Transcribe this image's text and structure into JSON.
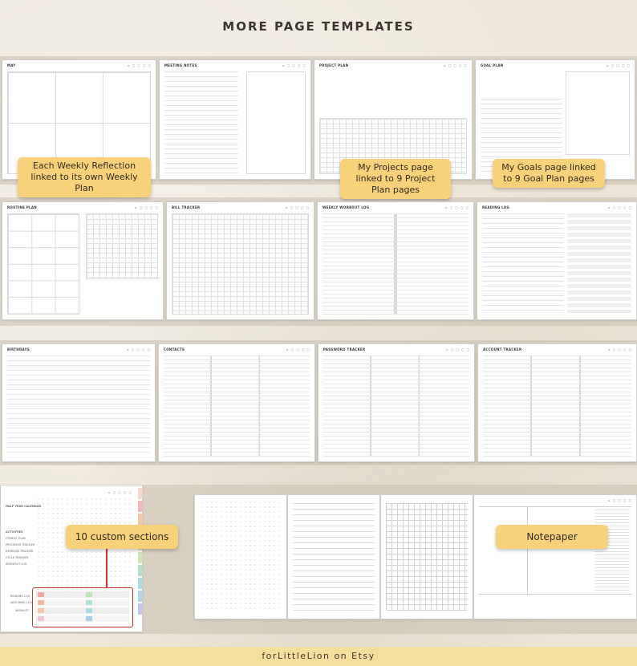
{
  "heading": "MORE PAGE TEMPLATES",
  "footer": "forLittleLion on Etsy",
  "callouts": {
    "weekly": "Each Weekly Reflection linked to its own Weekly Plan",
    "projects": "My Projects page linked to 9 Project Plan pages",
    "goals": "My Goals page linked to 9 Goal Plan pages",
    "sections": "10 custom sections",
    "notepaper": "Notepaper"
  },
  "row1": [
    "MAY",
    "MEETING NOTES",
    "PROJECT PLAN",
    "GOAL PLAN"
  ],
  "row2": [
    "ROUTINE PLAN",
    "BILL TRACKER",
    "WEEKLY WORKOUT LOG",
    "READING LOG"
  ],
  "row3": [
    "BIRTHDAYS",
    "CONTACTS",
    "PASSWORD TRACKER",
    "ACCOUNT TRACKER"
  ],
  "sections_page": {
    "heading": "HALF YEAR CALENDAR",
    "items": [
      "ACTIVITIES",
      "FITNESS PLAN",
      "PROGRESS TRACKER",
      "EXERCISE TRACKER",
      "CYCLE TRACKER",
      "WORKOUT LOG",
      "READING LOG",
      "WATCHING LOG",
      "WISHLIST"
    ]
  },
  "icons_text": "⌂ ◻ ◻ ◻ ◻",
  "colors": {
    "callout": "#f7d27a",
    "accent_line": "#c0392b",
    "footer": "#f5df9c"
  }
}
